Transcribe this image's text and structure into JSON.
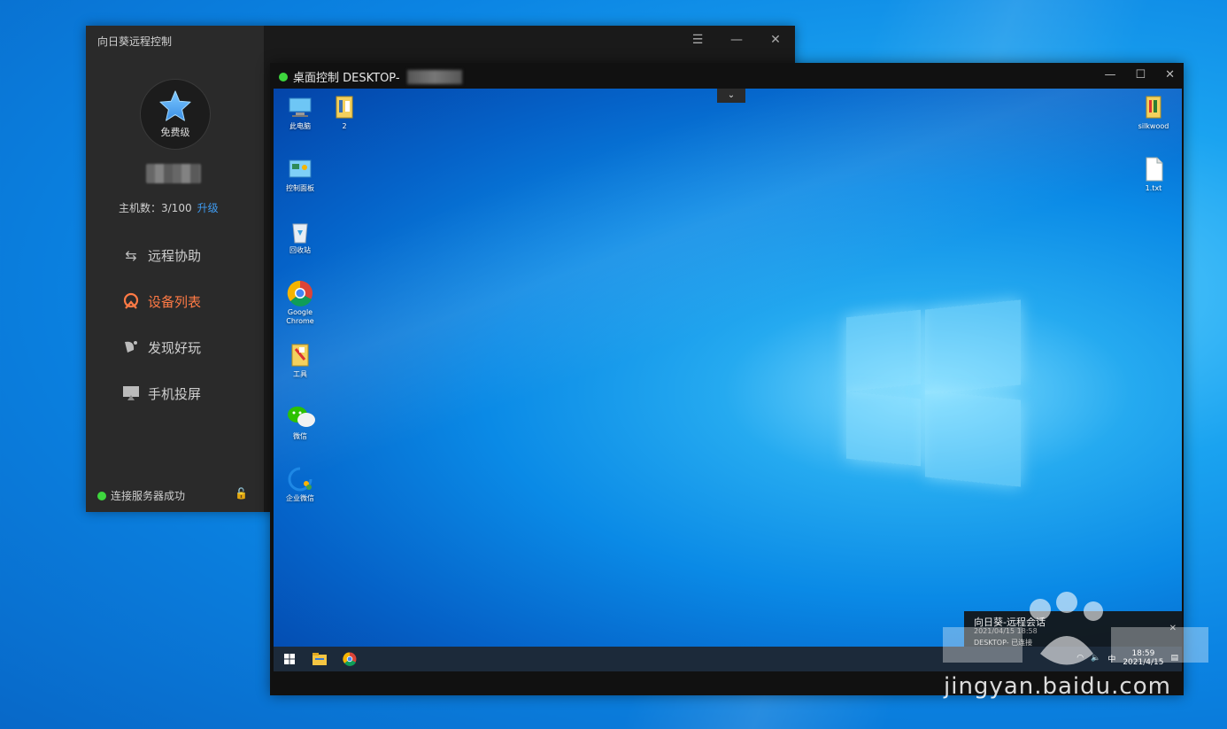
{
  "colors": {
    "accent_orange": "#ff7a45",
    "link_blue": "#3f9bf0",
    "status_green": "#3ed63e"
  },
  "main": {
    "title": "向日葵远程控制",
    "level_badge": "免费级",
    "hosts_label": "主机数：3/100",
    "upgrade_link": "升级",
    "nav": [
      {
        "label": "远程协助",
        "icon": "transfer-arrows-icon"
      },
      {
        "label": "设备列表",
        "icon": "device-list-icon",
        "active": true
      },
      {
        "label": "发现好玩",
        "icon": "discover-icon"
      },
      {
        "label": "手机投屏",
        "icon": "screen-cast-icon"
      }
    ],
    "status_text": "连接服务器成功"
  },
  "remote": {
    "title": "桌面控制 DESKTOP-",
    "desktop_icons": [
      {
        "label": "此电脑",
        "icon": "this-pc-icon"
      },
      {
        "label": "2",
        "icon": "folder-icon"
      },
      {
        "label": "控制面板",
        "icon": "control-panel-icon"
      },
      {
        "label": "回收站",
        "icon": "recycle-bin-icon"
      },
      {
        "label": "Google Chrome",
        "icon": "chrome-icon"
      },
      {
        "label": "工具",
        "icon": "tools-folder-icon"
      },
      {
        "label": "微信",
        "icon": "wechat-icon"
      },
      {
        "label": "企业微信",
        "icon": "wecom-icon"
      },
      {
        "label": "silkwood",
        "icon": "silkwood-icon"
      },
      {
        "label": "1.txt",
        "icon": "text-file-icon"
      }
    ],
    "toast": {
      "title": "向日葵-远程会话",
      "time": "2021/04/15 18:58",
      "line": "DESKTOP- 已连接"
    },
    "clock_time": "18:59",
    "clock_date": "2021/4/15",
    "tray_lang": "中"
  },
  "watermark": {
    "text": "jingyan.baidu.com"
  }
}
